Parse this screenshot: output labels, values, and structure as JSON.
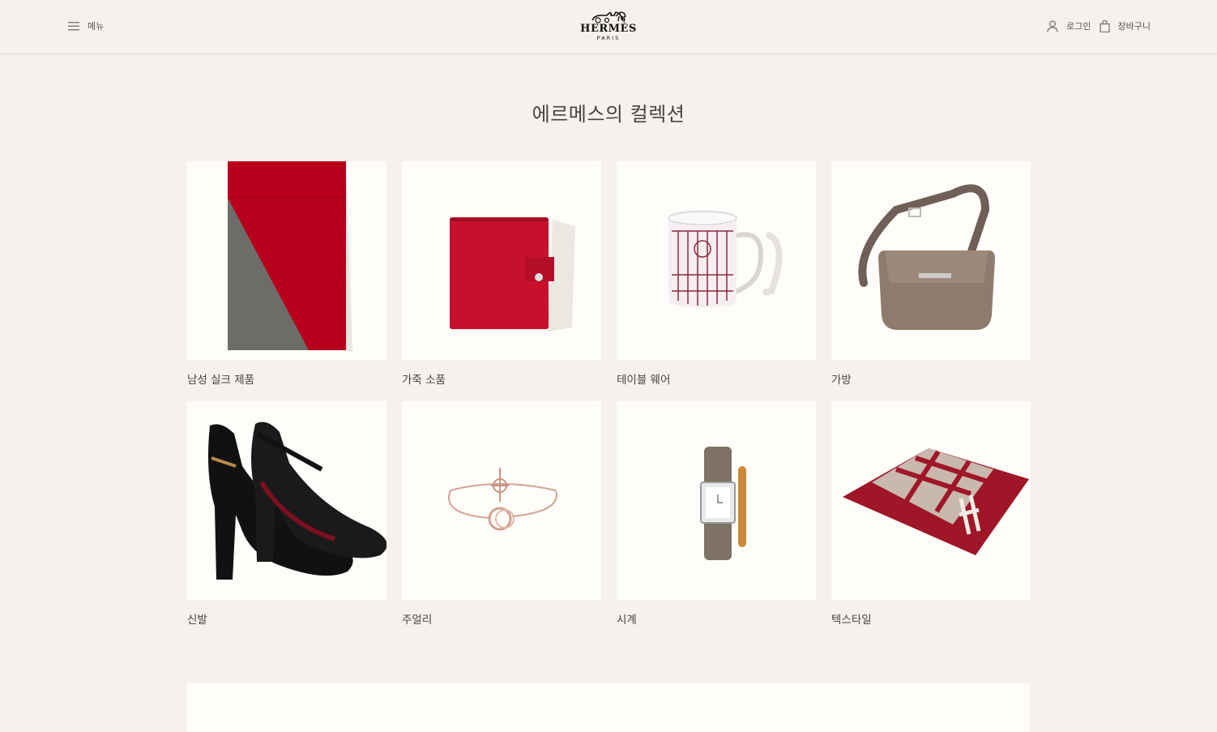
{
  "header": {
    "menu_label": "메뉴",
    "logo_text": "HERMÈS",
    "logo_subtext": "PARIS",
    "login_label": "로그인",
    "cart_label": "장바구니"
  },
  "main": {
    "title": "에르메스의 컬렉션",
    "categories": [
      {
        "label": "남성 실크 제품",
        "icon": "scarf-image"
      },
      {
        "label": "가죽 소품",
        "icon": "leather-notebook-image"
      },
      {
        "label": "테이블 웨어",
        "icon": "mug-image"
      },
      {
        "label": "가방",
        "icon": "shoulder-bag-image"
      },
      {
        "label": "신발",
        "icon": "heels-image"
      },
      {
        "label": "주얼리",
        "icon": "bracelet-image"
      },
      {
        "label": "시계",
        "icon": "watch-image"
      },
      {
        "label": "텍스타일",
        "icon": "cushion-image"
      }
    ]
  },
  "colors": {
    "background": "#f6f1ed",
    "card_background": "#fffdf9",
    "hermes_red": "#b8001c"
  }
}
